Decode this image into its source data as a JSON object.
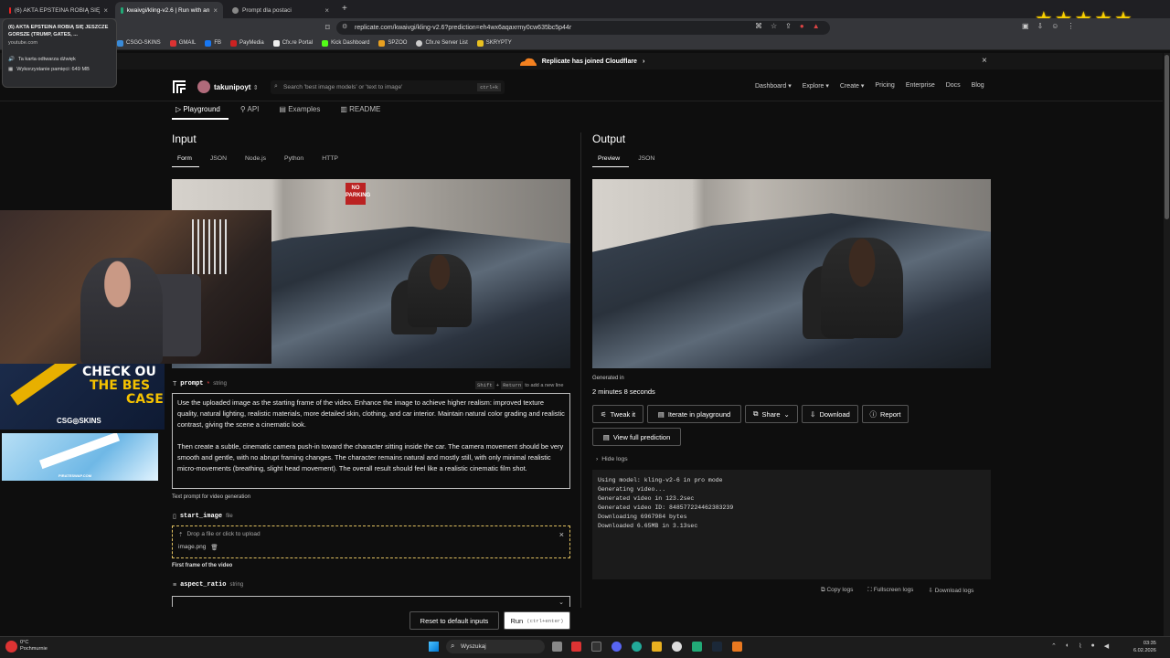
{
  "browser": {
    "tabs": [
      {
        "title": "(6) AKTA EPSTEINA ROBIĄ SIĘ"
      },
      {
        "title": "kwaivgi/kling-v2.6 | Run with an"
      },
      {
        "title": "Prompt dla postaci"
      }
    ],
    "url": "replicate.com/kwaivgi/kling-v2.6?prediction=eh4wx6aqaxrmy0cw635bc5p44r",
    "bookmarks": [
      "CSGO-SKINS",
      "GMAIL",
      "FB",
      "PayMedia",
      "Cfx.re Portal",
      "Kick Dashboard",
      "SPZOO",
      "Cfx.re Server List",
      "SKRYPTY"
    ],
    "tooltip": {
      "title": "(6) AKTA EPSTEINA ROBIĄ SIĘ JESZCZE GORSZE (TRUMP, GATES, ...",
      "domain": "youtube.com",
      "audio": "Ta karta odtwarza dźwięk",
      "memory": "Wykorzystanie pamięci: 649 MB"
    }
  },
  "banner": {
    "text": "Replicate has joined Cloudflare",
    "arrow": "›",
    "close": "×"
  },
  "nav": {
    "username": "takunipoyt",
    "search_placeholder": "Search 'best image models' or 'text to image'",
    "search_kbd": "ctrl+k",
    "links": [
      "Dashboard",
      "Explore",
      "Create",
      "Pricing",
      "Enterprise",
      "Docs",
      "Blog"
    ]
  },
  "page_tabs": [
    "Playground",
    "API",
    "Examples",
    "README"
  ],
  "input": {
    "heading": "Input",
    "tabs": [
      "Form",
      "JSON",
      "Node.js",
      "Python",
      "HTTP"
    ],
    "image_sign": "NO PARKING",
    "prompt_label": "prompt",
    "prompt_required": "*",
    "prompt_type": "string",
    "prompt_hint": "Shift + Return to add a new line",
    "prompt_hint_keys": [
      "Shift",
      "Return"
    ],
    "prompt_hint_text": "to add a new line",
    "prompt_value": "Use the uploaded image as the starting frame of the video. Enhance the image to achieve higher realism: improved texture quality, natural lighting, realistic materials, more detailed skin, clothing, and car interior. Maintain natural color grading and realistic contrast, giving the scene a cinematic look.\n\nThen create a subtle, cinematic camera push-in toward the character sitting inside the car. The camera movement should be very smooth and gentle, with no abrupt framing changes. The character remains natural and mostly still, with only minimal realistic micro-movements (breathing, slight head movement). The overall result should feel like a realistic cinematic film shot.",
    "prompt_desc": "Text prompt for video generation",
    "start_image_label": "start_image",
    "start_image_type": "file",
    "upload_text": "Drop a file or click to upload",
    "upload_file": "image.png",
    "start_image_desc": "First frame of the video",
    "aspect_label": "aspect_ratio",
    "aspect_type": "string",
    "reset_button": "Reset to default inputs",
    "run_button": "Run",
    "run_kbd": "(ctrl+enter)"
  },
  "output": {
    "heading": "Output",
    "tabs": [
      "Preview",
      "JSON"
    ],
    "generated_label": "Generated in",
    "generated_value": "2 minutes 8 seconds",
    "buttons": [
      "Tweak it",
      "Iterate in playground",
      "Share",
      "Download",
      "Report"
    ],
    "view_full": "View full prediction",
    "hide_logs": "Hide logs",
    "logs": [
      "Using model: kling-v2-6 in pro mode",
      "Generating video...",
      "Generated video in 123.2sec",
      "Generated video ID: 848577224462383239",
      "Downloading 6967984 bytes",
      "Downloaded 6.65MB in 3.13sec"
    ],
    "log_actions": [
      "Copy logs",
      "Fullscreen logs",
      "Download logs"
    ]
  },
  "overlay": {
    "ad1_lines": [
      "CHECK OU",
      "THE BES",
      "CASE"
    ],
    "ad1_brand": "CSG◎SKINS",
    "ad2_brand": "PIRATESWAP.COM"
  },
  "taskbar": {
    "weather_temp": "0°C",
    "weather_desc": "Pochmurnie",
    "search": "Wyszukaj",
    "time": "03:35",
    "date": "6.02.2026"
  },
  "colors": {
    "accent_yellow": "#f7d000",
    "brand_red": "#d33",
    "cloudflare": "#f48120"
  }
}
